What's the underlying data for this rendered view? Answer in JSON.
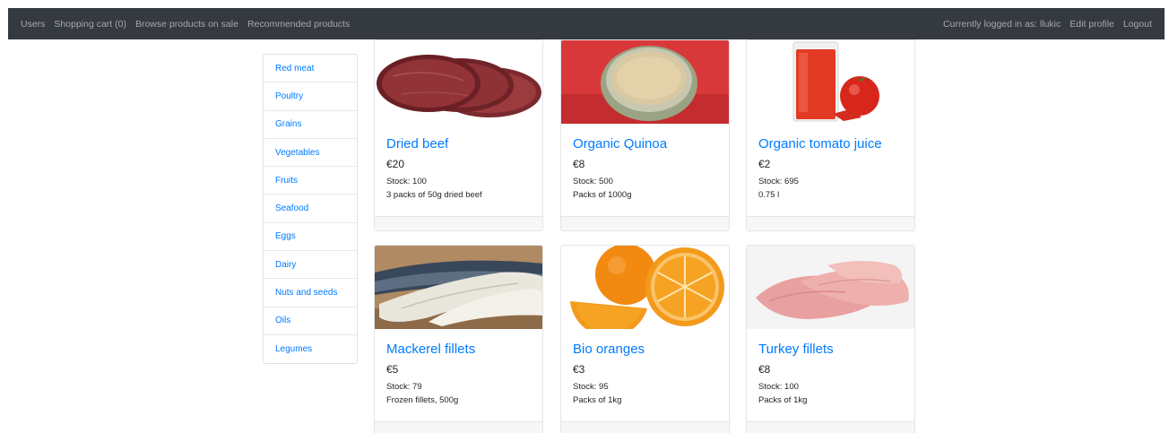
{
  "navbar": {
    "left_links": [
      {
        "label": "Users"
      },
      {
        "label": "Shopping cart (0)"
      },
      {
        "label": "Browse products on sale"
      },
      {
        "label": "Recommended products"
      }
    ],
    "logged_in_text": "Currently logged in as: llukic",
    "edit_profile": "Edit profile",
    "logout": "Logout"
  },
  "categories": [
    "Red meat",
    "Poultry",
    "Grains",
    "Vegetables",
    "Fruits",
    "Seafood",
    "Eggs",
    "Dairy",
    "Nuts and seeds",
    "Oils",
    "Legumes"
  ],
  "products": [
    {
      "name": "Dried beef",
      "price": "€20",
      "stock": "Stock: 100",
      "description": "3 packs of 50g dried beef",
      "image": "dried-beef-image"
    },
    {
      "name": "Organic Quinoa",
      "price": "€8",
      "stock": "Stock: 500",
      "description": "Packs of 1000g",
      "image": "quinoa-image"
    },
    {
      "name": "Organic tomato juice",
      "price": "€2",
      "stock": "Stock: 695",
      "description": "0.75 l",
      "image": "tomato-juice-image"
    },
    {
      "name": "Mackerel fillets",
      "price": "€5",
      "stock": "Stock: 79",
      "description": "Frozen fillets, 500g",
      "image": "mackerel-image"
    },
    {
      "name": "Bio oranges",
      "price": "€3",
      "stock": "Stock: 95",
      "description": "Packs of 1kg",
      "image": "oranges-image"
    },
    {
      "name": "Turkey fillets",
      "price": "€8",
      "stock": "Stock: 100",
      "description": "Packs of 1kg",
      "image": "turkey-image"
    }
  ],
  "colors": {
    "navbar": "#343a40",
    "link": "#007bff",
    "footer": "#f7f7f7"
  }
}
